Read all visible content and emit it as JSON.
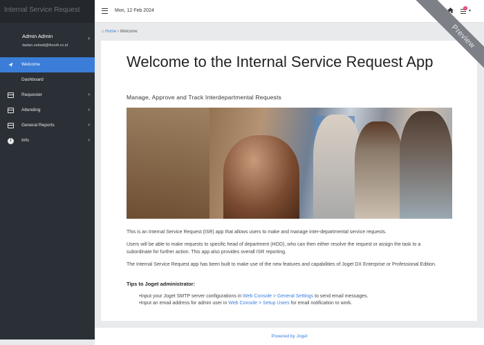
{
  "sidebar": {
    "brand": "Internal Service Request",
    "user": {
      "name": "Admin Admin",
      "email": "dadan.setiadi@ifosoft.co.id"
    },
    "items": [
      {
        "label": "Welcome",
        "icon": "paper-plane-icon",
        "active": true
      },
      {
        "label": "Dashboard",
        "icon": "",
        "active": false
      },
      {
        "label": "Requester",
        "icon": "card-icon",
        "active": false
      },
      {
        "label": "Attending",
        "icon": "card-icon",
        "active": false
      },
      {
        "label": "General Reports",
        "icon": "card-icon",
        "active": false
      },
      {
        "label": "Info",
        "icon": "info-icon",
        "active": false
      }
    ]
  },
  "topbar": {
    "date": "Mon, 12 Feb 2024",
    "notification_count": "0"
  },
  "ribbon": {
    "text": "Preview"
  },
  "breadcrumb": {
    "home": "Home",
    "separator": "›",
    "current": "Welcome"
  },
  "content": {
    "title": "Welcome to the Internal Service Request App",
    "subtitle": "Manage, Approve and Track Interdepartmental Requests",
    "paragraphs": [
      "This is an Internal Service Request (ISR) app that allows users to make and manage inter-departmental service requests.",
      "Users will be able to make requests to specific head of department (HOD), who can then either resolve the request or assign the task to a subordinate for further action. This app also provides overall ISR reporting.",
      "The Internal Service Request app has been built to make use of the new features and capabilities of Joget DX Enterprise or Professional Edition."
    ],
    "tips_heading": "Tips to Joget administrator:",
    "tips": [
      {
        "before": "•Input your Joget SMTP server configurations in ",
        "link": "Web Console > General Settings",
        "after": " to send email messages."
      },
      {
        "before": "•Input an email address for admin user in ",
        "link": "Web Console > Setup Users",
        "after": " for email notification to work."
      }
    ]
  },
  "footer": {
    "text": "Powered by Joget"
  },
  "colors": {
    "sidebar": "#2b3036",
    "active": "#3b7dd8",
    "link": "#3b7dd8",
    "badge": "#d83a7a"
  }
}
